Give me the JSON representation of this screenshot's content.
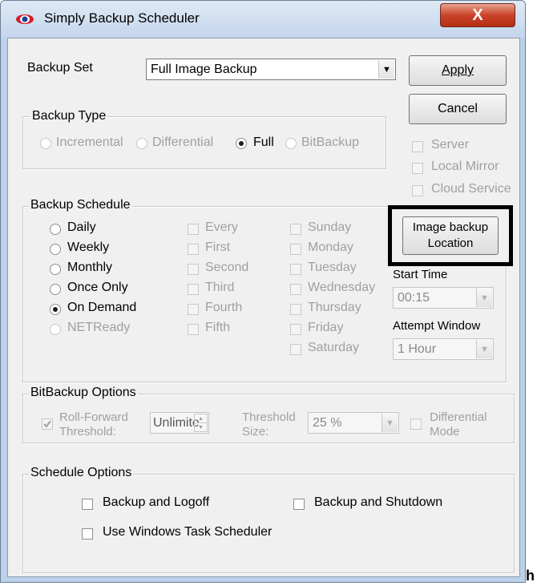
{
  "window": {
    "title": "Simply Backup Scheduler",
    "close_label": "X"
  },
  "backup_set": {
    "label": "Backup Set",
    "value": "Full Image Backup"
  },
  "buttons": {
    "apply": "Apply",
    "cancel": "Cancel",
    "image_location": "Image backup Location"
  },
  "backup_type": {
    "title": "Backup Type",
    "options": [
      {
        "label": "Incremental",
        "selected": false,
        "enabled": false
      },
      {
        "label": "Differential",
        "selected": false,
        "enabled": false
      },
      {
        "label": "Full",
        "selected": true,
        "enabled": true
      },
      {
        "label": "BitBackup",
        "selected": false,
        "enabled": false
      }
    ]
  },
  "destinations": [
    {
      "label": "Server",
      "checked": false,
      "enabled": false
    },
    {
      "label": "Local Mirror",
      "checked": false,
      "enabled": false
    },
    {
      "label": "Cloud Service",
      "checked": false,
      "enabled": false
    }
  ],
  "schedule": {
    "title": "Backup Schedule",
    "frequency": [
      {
        "label": "Daily",
        "selected": false,
        "enabled": true
      },
      {
        "label": "Weekly",
        "selected": false,
        "enabled": true
      },
      {
        "label": "Monthly",
        "selected": false,
        "enabled": true
      },
      {
        "label": "Once Only",
        "selected": false,
        "enabled": true
      },
      {
        "label": "On Demand",
        "selected": true,
        "enabled": true
      },
      {
        "label": "NETReady",
        "selected": false,
        "enabled": false
      }
    ],
    "occurrence": [
      "Every",
      "First",
      "Second",
      "Third",
      "Fourth",
      "Fifth"
    ],
    "days": [
      "Sunday",
      "Monday",
      "Tuesday",
      "Wednesday",
      "Thursday",
      "Friday",
      "Saturday"
    ],
    "start_time_label": "Start Time",
    "start_time_value": "00:15",
    "attempt_window_label": "Attempt Window",
    "attempt_window_value": "1 Hour"
  },
  "bitbackup": {
    "title": "BitBackup Options",
    "rollforward_label_1": "Roll-Forward",
    "rollforward_label_2": "Threshold:",
    "rollforward_checked": true,
    "rollforward_value": "Unlimite",
    "threshold_size_label_1": "Threshold",
    "threshold_size_label_2": "Size:",
    "threshold_size_value": "25 %",
    "differential_label_1": "Differential",
    "differential_label_2": "Mode"
  },
  "schedule_options": {
    "title": "Schedule Options",
    "backup_logoff": "Backup and Logoff",
    "backup_shutdown": "Backup and Shutdown",
    "use_task_scheduler": "Use Windows Task Scheduler"
  },
  "edge_fragment": "h",
  "colors": {
    "title_bg": "#c4d6ec",
    "close": "#c9432a",
    "client_bg": "#f0f0f0",
    "highlight_border": "#000000"
  }
}
